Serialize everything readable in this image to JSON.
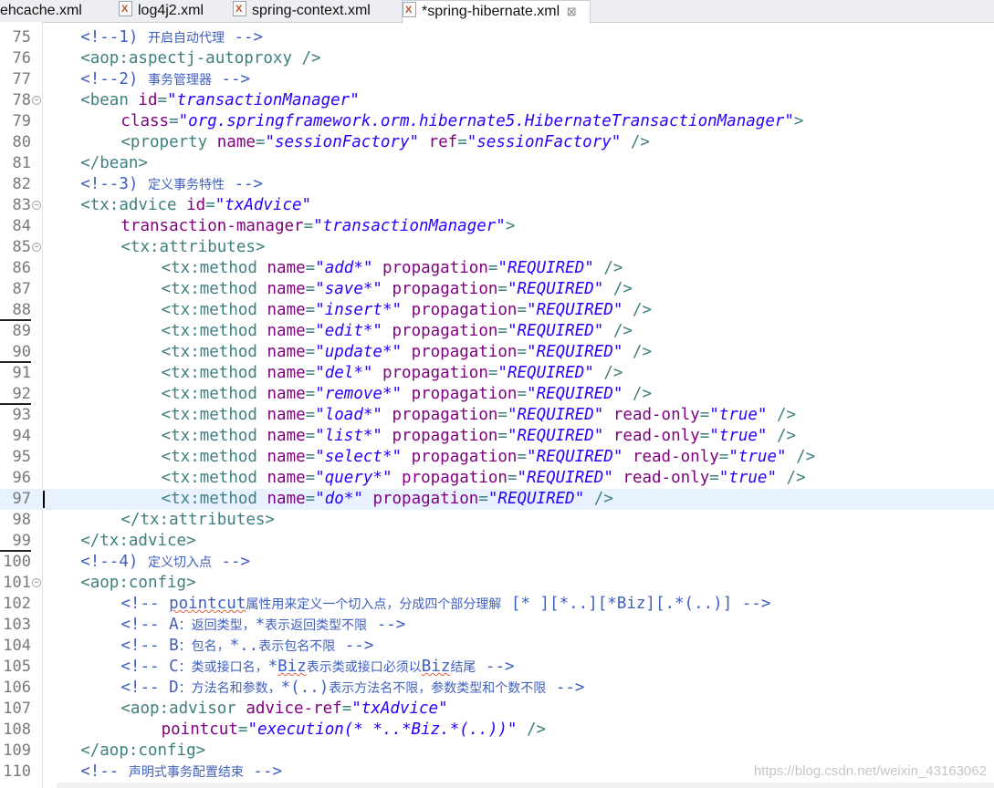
{
  "tabs": [
    {
      "label": "ehcache.xml",
      "active": false
    },
    {
      "label": "log4j2.xml",
      "active": false
    },
    {
      "label": "spring-context.xml",
      "active": false
    },
    {
      "label": "*spring-hibernate.xml",
      "active": true
    }
  ],
  "tab_close_glyph": "⊠",
  "current_line": "97",
  "watermark": "https://blog.csdn.net/weixin_43163062",
  "lines": [
    {
      "n": "75",
      "indent": 4,
      "tokens": [
        [
          "c",
          "<!--1) "
        ],
        [
          "cj",
          "开启自动代理"
        ],
        [
          "c",
          " -->"
        ]
      ]
    },
    {
      "n": "76",
      "indent": 4,
      "tokens": [
        [
          "t",
          "<aop:aspectj-autoproxy />"
        ]
      ]
    },
    {
      "n": "77",
      "indent": 4,
      "tokens": [
        [
          "c",
          "<!--2) "
        ],
        [
          "cj",
          "事务管理器"
        ],
        [
          "c",
          " -->"
        ]
      ]
    },
    {
      "n": "78",
      "indent": 4,
      "fold": true,
      "tokens": [
        [
          "t",
          "<bean "
        ],
        [
          "a",
          "id"
        ],
        [
          "t",
          "="
        ],
        [
          "v",
          "\"transactionManager\""
        ]
      ]
    },
    {
      "n": "79",
      "indent": 8,
      "tokens": [
        [
          "a",
          "class"
        ],
        [
          "t",
          "="
        ],
        [
          "v",
          "\"org.springframework.orm.hibernate5.HibernateTransactionManager\""
        ],
        [
          "t",
          ">"
        ]
      ]
    },
    {
      "n": "80",
      "indent": 8,
      "tokens": [
        [
          "t",
          "<property "
        ],
        [
          "a",
          "name"
        ],
        [
          "t",
          "="
        ],
        [
          "v",
          "\"sessionFactory\""
        ],
        [
          "t",
          " "
        ],
        [
          "a",
          "ref"
        ],
        [
          "t",
          "="
        ],
        [
          "v",
          "\"sessionFactory\""
        ],
        [
          "t",
          " />"
        ]
      ]
    },
    {
      "n": "81",
      "indent": 4,
      "tokens": [
        [
          "t",
          "</bean>"
        ]
      ]
    },
    {
      "n": "82",
      "indent": 4,
      "tokens": [
        [
          "c",
          "<!--3) "
        ],
        [
          "cj",
          "定义事务特性"
        ],
        [
          "c",
          " -->"
        ]
      ]
    },
    {
      "n": "83",
      "indent": 4,
      "fold": true,
      "tokens": [
        [
          "t",
          "<tx:advice "
        ],
        [
          "a",
          "id"
        ],
        [
          "t",
          "="
        ],
        [
          "v",
          "\"txAdvice\""
        ]
      ]
    },
    {
      "n": "84",
      "indent": 8,
      "tokens": [
        [
          "a",
          "transaction-manager"
        ],
        [
          "t",
          "="
        ],
        [
          "v",
          "\"transactionManager\""
        ],
        [
          "t",
          ">"
        ]
      ]
    },
    {
      "n": "85",
      "indent": 8,
      "fold": true,
      "tokens": [
        [
          "t",
          "<tx:attributes>"
        ]
      ]
    },
    {
      "n": "86",
      "indent": 12,
      "tokens": [
        [
          "t",
          "<tx:method "
        ],
        [
          "a",
          "name"
        ],
        [
          "t",
          "="
        ],
        [
          "v",
          "\"add*\""
        ],
        [
          "t",
          " "
        ],
        [
          "a",
          "propagation"
        ],
        [
          "t",
          "="
        ],
        [
          "v",
          "\"REQUIRED\""
        ],
        [
          "t",
          " />"
        ]
      ]
    },
    {
      "n": "87",
      "indent": 12,
      "tokens": [
        [
          "t",
          "<tx:method "
        ],
        [
          "a",
          "name"
        ],
        [
          "t",
          "="
        ],
        [
          "v",
          "\"save*\""
        ],
        [
          "t",
          " "
        ],
        [
          "a",
          "propagation"
        ],
        [
          "t",
          "="
        ],
        [
          "v",
          "\"REQUIRED\""
        ],
        [
          "t",
          " />"
        ]
      ]
    },
    {
      "n": "88",
      "indent": 12,
      "marked": true,
      "tokens": [
        [
          "t",
          "<tx:method "
        ],
        [
          "a",
          "name"
        ],
        [
          "t",
          "="
        ],
        [
          "v",
          "\"insert*\""
        ],
        [
          "t",
          " "
        ],
        [
          "a",
          "propagation"
        ],
        [
          "t",
          "="
        ],
        [
          "v",
          "\"REQUIRED\""
        ],
        [
          "t",
          " />"
        ]
      ]
    },
    {
      "n": "89",
      "indent": 12,
      "tokens": [
        [
          "t",
          "<tx:method "
        ],
        [
          "a",
          "name"
        ],
        [
          "t",
          "="
        ],
        [
          "v",
          "\"edit*\""
        ],
        [
          "t",
          " "
        ],
        [
          "a",
          "propagation"
        ],
        [
          "t",
          "="
        ],
        [
          "v",
          "\"REQUIRED\""
        ],
        [
          "t",
          " />"
        ]
      ]
    },
    {
      "n": "90",
      "indent": 12,
      "marked": true,
      "tokens": [
        [
          "t",
          "<tx:method "
        ],
        [
          "a",
          "name"
        ],
        [
          "t",
          "="
        ],
        [
          "v",
          "\"update*\""
        ],
        [
          "t",
          " "
        ],
        [
          "a",
          "propagation"
        ],
        [
          "t",
          "="
        ],
        [
          "v",
          "\"REQUIRED\""
        ],
        [
          "t",
          " />"
        ]
      ]
    },
    {
      "n": "91",
      "indent": 12,
      "tokens": [
        [
          "t",
          "<tx:method "
        ],
        [
          "a",
          "name"
        ],
        [
          "t",
          "="
        ],
        [
          "v",
          "\"del*\""
        ],
        [
          "t",
          " "
        ],
        [
          "a",
          "propagation"
        ],
        [
          "t",
          "="
        ],
        [
          "v",
          "\"REQUIRED\""
        ],
        [
          "t",
          " />"
        ]
      ]
    },
    {
      "n": "92",
      "indent": 12,
      "marked": true,
      "tokens": [
        [
          "t",
          "<tx:method "
        ],
        [
          "a",
          "name"
        ],
        [
          "t",
          "="
        ],
        [
          "v",
          "\"remove*\""
        ],
        [
          "t",
          " "
        ],
        [
          "a",
          "propagation"
        ],
        [
          "t",
          "="
        ],
        [
          "v",
          "\"REQUIRED\""
        ],
        [
          "t",
          " />"
        ]
      ]
    },
    {
      "n": "93",
      "indent": 12,
      "tokens": [
        [
          "t",
          "<tx:method "
        ],
        [
          "a",
          "name"
        ],
        [
          "t",
          "="
        ],
        [
          "v",
          "\"load*\""
        ],
        [
          "t",
          " "
        ],
        [
          "a",
          "propagation"
        ],
        [
          "t",
          "="
        ],
        [
          "v",
          "\"REQUIRED\""
        ],
        [
          "t",
          " "
        ],
        [
          "a",
          "read-only"
        ],
        [
          "t",
          "="
        ],
        [
          "v",
          "\"true\""
        ],
        [
          "t",
          " />"
        ]
      ]
    },
    {
      "n": "94",
      "indent": 12,
      "tokens": [
        [
          "t",
          "<tx:method "
        ],
        [
          "a",
          "name"
        ],
        [
          "t",
          "="
        ],
        [
          "v",
          "\"list*\""
        ],
        [
          "t",
          " "
        ],
        [
          "a",
          "propagation"
        ],
        [
          "t",
          "="
        ],
        [
          "v",
          "\"REQUIRED\""
        ],
        [
          "t",
          " "
        ],
        [
          "a",
          "read-only"
        ],
        [
          "t",
          "="
        ],
        [
          "v",
          "\"true\""
        ],
        [
          "t",
          " />"
        ]
      ]
    },
    {
      "n": "95",
      "indent": 12,
      "tokens": [
        [
          "t",
          "<tx:method "
        ],
        [
          "a",
          "name"
        ],
        [
          "t",
          "="
        ],
        [
          "v",
          "\"select*\""
        ],
        [
          "t",
          " "
        ],
        [
          "a",
          "propagation"
        ],
        [
          "t",
          "="
        ],
        [
          "v",
          "\"REQUIRED\""
        ],
        [
          "t",
          " "
        ],
        [
          "a",
          "read-only"
        ],
        [
          "t",
          "="
        ],
        [
          "v",
          "\"true\""
        ],
        [
          "t",
          " />"
        ]
      ]
    },
    {
      "n": "96",
      "indent": 12,
      "tokens": [
        [
          "t",
          "<tx:method "
        ],
        [
          "a",
          "name"
        ],
        [
          "t",
          "="
        ],
        [
          "v",
          "\"query*\""
        ],
        [
          "t",
          " "
        ],
        [
          "a",
          "propagation"
        ],
        [
          "t",
          "="
        ],
        [
          "v",
          "\"REQUIRED\""
        ],
        [
          "t",
          " "
        ],
        [
          "a",
          "read-only"
        ],
        [
          "t",
          "="
        ],
        [
          "v",
          "\"true\""
        ],
        [
          "t",
          " />"
        ]
      ]
    },
    {
      "n": "97",
      "indent": 12,
      "tokens": [
        [
          "t",
          "<tx:method "
        ],
        [
          "a",
          "name"
        ],
        [
          "t",
          "="
        ],
        [
          "v",
          "\"do*\""
        ],
        [
          "t",
          " "
        ],
        [
          "a",
          "propagation"
        ],
        [
          "t",
          "="
        ],
        [
          "v",
          "\"REQUIRED\""
        ],
        [
          "t",
          " />"
        ]
      ]
    },
    {
      "n": "98",
      "indent": 8,
      "tokens": [
        [
          "t",
          "</tx:attributes>"
        ]
      ]
    },
    {
      "n": "99",
      "indent": 4,
      "marked": true,
      "tokens": [
        [
          "t",
          "</tx:advice>"
        ]
      ]
    },
    {
      "n": "100",
      "indent": 4,
      "tokens": [
        [
          "c",
          "<!--4) "
        ],
        [
          "cj",
          "定义切入点"
        ],
        [
          "c",
          " -->"
        ]
      ]
    },
    {
      "n": "101",
      "indent": 4,
      "fold": true,
      "tokens": [
        [
          "t",
          "<aop:config>"
        ]
      ]
    },
    {
      "n": "102",
      "indent": 8,
      "tokens": [
        [
          "c",
          "<!-- "
        ],
        [
          "cs",
          "pointcut"
        ],
        [
          "cj",
          "属性用来定义一个切入点，分成四个部分理解"
        ],
        [
          "c",
          " [* ][*..][*Biz][.*(..)] -->"
        ]
      ]
    },
    {
      "n": "103",
      "indent": 8,
      "tokens": [
        [
          "c",
          "<!-- A"
        ],
        [
          "cj",
          "：返回类型，"
        ],
        [
          "c",
          "*"
        ],
        [
          "cj",
          "表示返回类型不限"
        ],
        [
          "c",
          " -->"
        ]
      ]
    },
    {
      "n": "104",
      "indent": 8,
      "tokens": [
        [
          "c",
          "<!-- B"
        ],
        [
          "cj",
          "：包名，"
        ],
        [
          "c",
          "*.."
        ],
        [
          "cj",
          "表示包名不限"
        ],
        [
          "c",
          " -->"
        ]
      ]
    },
    {
      "n": "105",
      "indent": 8,
      "tokens": [
        [
          "c",
          "<!-- C"
        ],
        [
          "cj",
          "：类或接口名，"
        ],
        [
          "c",
          "*"
        ],
        [
          "cs",
          "Biz"
        ],
        [
          "cj",
          "表示类或接口必须以"
        ],
        [
          "cs",
          "Biz"
        ],
        [
          "cj",
          "结尾"
        ],
        [
          "c",
          " -->"
        ]
      ]
    },
    {
      "n": "106",
      "indent": 8,
      "tokens": [
        [
          "c",
          "<!-- D"
        ],
        [
          "cj",
          "：方法名和参数，"
        ],
        [
          "c",
          "*(..)"
        ],
        [
          "cj",
          "表示方法名不限，参数类型和个数不限"
        ],
        [
          "c",
          " -->"
        ]
      ]
    },
    {
      "n": "107",
      "indent": 8,
      "tokens": [
        [
          "t",
          "<aop:advisor "
        ],
        [
          "a",
          "advice-ref"
        ],
        [
          "t",
          "="
        ],
        [
          "v",
          "\"txAdvice\""
        ]
      ]
    },
    {
      "n": "108",
      "indent": 12,
      "tokens": [
        [
          "a",
          "pointcut"
        ],
        [
          "t",
          "="
        ],
        [
          "v",
          "\"execution(* *..*Biz.*(..))\""
        ],
        [
          "t",
          " />"
        ]
      ]
    },
    {
      "n": "109",
      "indent": 4,
      "tokens": [
        [
          "t",
          "</aop:config>"
        ]
      ]
    },
    {
      "n": "110",
      "indent": 4,
      "tokens": [
        [
          "c",
          "<!-- "
        ],
        [
          "cj",
          "声明式事务配置结束"
        ],
        [
          "c",
          " -->"
        ]
      ]
    }
  ]
}
